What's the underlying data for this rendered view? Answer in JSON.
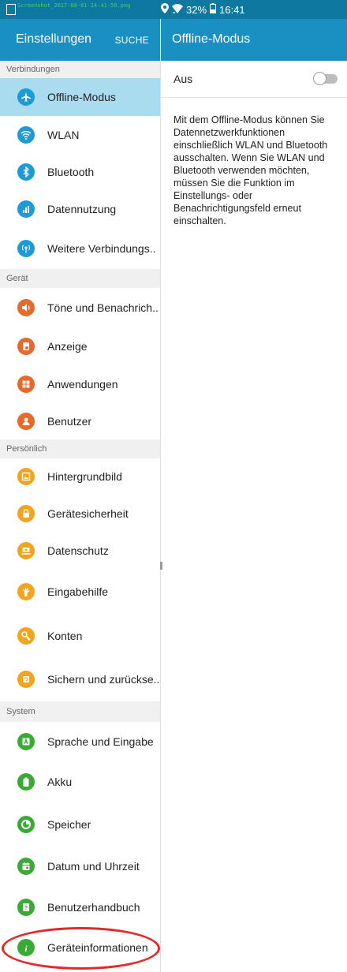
{
  "status_bar": {
    "filename": "Screenshot_2017-08-01-14-41-50.png",
    "battery": "32%",
    "time": "16:41"
  },
  "left_pane": {
    "title": "Einstellungen",
    "search_label": "SUCHE"
  },
  "right_pane": {
    "title": "Offline-Modus",
    "toggle_label": "Aus",
    "toggle_state": "off",
    "description": "Mit dem Offline-Modus können Sie Datennetzwerkfunktionen einschließlich WLAN und Bluetooth ausschalten. Wenn Sie WLAN und Bluetooth verwenden möchten, müssen Sie die Funktion im Einstellungs- oder Benachrichtigungsfeld erneut einschalten."
  },
  "sections": [
    {
      "title": "Verbindungen",
      "items": [
        {
          "label": "Offline-Modus",
          "icon": "airplane-icon",
          "color": "#1e9ad6",
          "selected": true
        },
        {
          "label": "WLAN",
          "icon": "wifi-icon",
          "color": "#1e9ad6"
        },
        {
          "label": "Bluetooth",
          "icon": "bluetooth-icon",
          "color": "#1e9ad6"
        },
        {
          "label": "Datennutzung",
          "icon": "data-usage-icon",
          "color": "#1e9ad6"
        },
        {
          "label": "Weitere Verbindungs..",
          "icon": "more-connections-icon",
          "color": "#1e9ad6"
        }
      ]
    },
    {
      "title": "Gerät",
      "items": [
        {
          "label": "Töne und Benachrich..",
          "icon": "sound-icon",
          "color": "#e8692c"
        },
        {
          "label": "Anzeige",
          "icon": "display-icon",
          "color": "#e8692c"
        },
        {
          "label": "Anwendungen",
          "icon": "apps-icon",
          "color": "#e8692c"
        },
        {
          "label": "Benutzer",
          "icon": "user-icon",
          "color": "#e8692c"
        }
      ]
    },
    {
      "title": "Persönlich",
      "items": [
        {
          "label": "Hintergrundbild",
          "icon": "wallpaper-icon",
          "color": "#f2a41e"
        },
        {
          "label": "Gerätesicherheit",
          "icon": "lock-icon",
          "color": "#f2a41e"
        },
        {
          "label": "Datenschutz",
          "icon": "privacy-icon",
          "color": "#f2a41e"
        },
        {
          "label": "Eingabehilfe",
          "icon": "accessibility-icon",
          "color": "#f2a41e"
        },
        {
          "label": "Konten",
          "icon": "key-icon",
          "color": "#f2a41e"
        },
        {
          "label": "Sichern und zurückse..",
          "icon": "backup-icon",
          "color": "#f2a41e"
        }
      ]
    },
    {
      "title": "System",
      "items": [
        {
          "label": "Sprache und Eingabe",
          "icon": "language-icon",
          "color": "#3aaa35"
        },
        {
          "label": "Akku",
          "icon": "battery-icon",
          "color": "#3aaa35"
        },
        {
          "label": "Speicher",
          "icon": "storage-icon",
          "color": "#3aaa35"
        },
        {
          "label": "Datum und Uhrzeit",
          "icon": "calendar-icon",
          "color": "#3aaa35"
        },
        {
          "label": "Benutzerhandbuch",
          "icon": "manual-icon",
          "color": "#3aaa35"
        },
        {
          "label": "Geräteinformationen",
          "icon": "info-icon",
          "color": "#3aaa35"
        }
      ]
    }
  ],
  "annotation_color": "#e22a2a"
}
